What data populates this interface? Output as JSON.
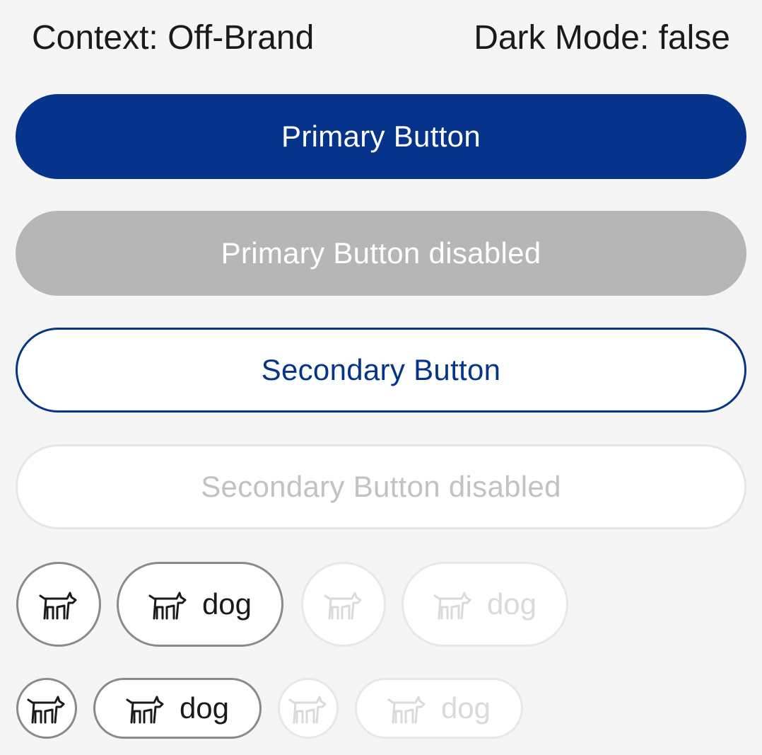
{
  "header": {
    "context_label": "Context: Off-Brand",
    "dark_mode_label": "Dark Mode: false"
  },
  "buttons": {
    "primary": "Primary Button",
    "primary_disabled": "Primary Button disabled",
    "secondary": "Secondary Button",
    "secondary_disabled": "Secondary Button disabled"
  },
  "icon_chips": {
    "icon": "dog-icon",
    "label": "dog"
  },
  "colors": {
    "brand": "#06348b",
    "disabled_fill": "#b6b6b6",
    "chip_border": "#8a8a8a",
    "disabled_text": "#c2c2c2",
    "background": "#f5f5f5"
  }
}
